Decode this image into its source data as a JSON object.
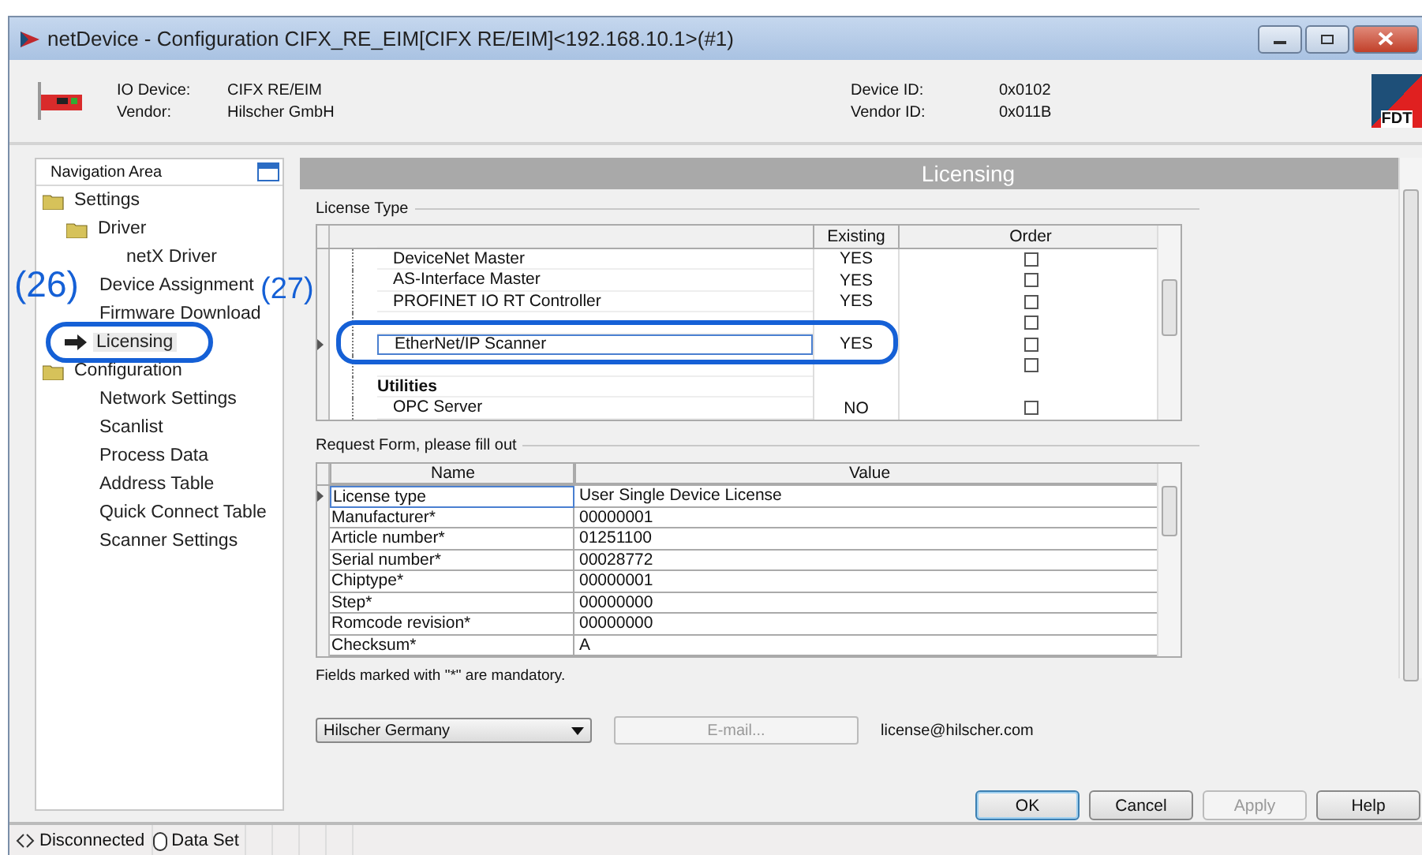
{
  "window": {
    "title": "netDevice - Configuration CIFX_RE_EIM[CIFX RE/EIM]<192.168.10.1>(#1)"
  },
  "device_info": {
    "left": [
      {
        "label": "IO Device:",
        "value": "CIFX RE/EIM"
      },
      {
        "label": "Vendor:",
        "value": "Hilscher GmbH"
      }
    ],
    "right": [
      {
        "label": "Device ID:",
        "value": "0x0102"
      },
      {
        "label": "Vendor ID:",
        "value": "0x011B"
      }
    ],
    "logo_text": "FDT"
  },
  "navigation": {
    "title": "Navigation Area",
    "items": [
      {
        "label": "Settings",
        "kind": "folder",
        "selected": false,
        "children": [
          {
            "label": "Driver",
            "kind": "folder",
            "selected": false,
            "children": [
              {
                "label": "netX Driver",
                "kind": "page",
                "selected": false
              }
            ]
          },
          {
            "label": "Device Assignment",
            "kind": "page",
            "selected": false
          },
          {
            "label": "Firmware Download",
            "kind": "page",
            "selected": false
          },
          {
            "label": "Licensing",
            "kind": "page",
            "selected": true
          }
        ]
      },
      {
        "label": "Configuration",
        "kind": "folder",
        "selected": false,
        "children": [
          {
            "label": "Network Settings",
            "kind": "page",
            "selected": false
          },
          {
            "label": "Scanlist",
            "kind": "page",
            "selected": false
          },
          {
            "label": "Process Data",
            "kind": "page",
            "selected": false
          },
          {
            "label": "Address Table",
            "kind": "page",
            "selected": false
          },
          {
            "label": "Quick Connect Table",
            "kind": "page",
            "selected": false
          },
          {
            "label": "Scanner Settings",
            "kind": "page",
            "selected": false
          }
        ]
      }
    ]
  },
  "annotations": [
    {
      "label": "(26)"
    },
    {
      "label": "(27)"
    }
  ],
  "panel": {
    "title": "Licensing"
  },
  "license_type": {
    "title": "License Type",
    "columns": [
      "Existing",
      "Order"
    ],
    "rows": [
      {
        "kind": "item",
        "name": "DeviceNet Master",
        "existing": "YES",
        "checked": false,
        "selected": false
      },
      {
        "kind": "item",
        "name": "AS-Interface Master",
        "existing": "YES",
        "checked": false,
        "selected": false
      },
      {
        "kind": "item",
        "name": "PROFINET IO RT Controller",
        "existing": "YES",
        "checked": false,
        "selected": false
      },
      {
        "kind": "item",
        "name": "",
        "existing": "",
        "checked": false,
        "selected": false
      },
      {
        "kind": "item",
        "name": "EtherNet/IP Scanner",
        "existing": "YES",
        "checked": false,
        "selected": true
      },
      {
        "kind": "item",
        "name": "",
        "existing": "",
        "checked": false,
        "selected": false
      },
      {
        "kind": "group",
        "name": "Utilities",
        "selected": false
      },
      {
        "kind": "item",
        "name": "OPC Server",
        "existing": "NO",
        "checked": false,
        "selected": false
      }
    ]
  },
  "request_form": {
    "title": "Request Form, please fill out",
    "columns": [
      "Name",
      "Value"
    ],
    "rows": [
      {
        "name": "License type",
        "value": "User Single Device License",
        "selected": true
      },
      {
        "name": "Manufacturer*",
        "value": "00000001",
        "selected": false
      },
      {
        "name": "Article number*",
        "value": "01251100",
        "selected": false
      },
      {
        "name": "Serial number*",
        "value": "00028772",
        "selected": false
      },
      {
        "name": "Chiptype*",
        "value": "00000001",
        "selected": false
      },
      {
        "name": "Step*",
        "value": "00000000",
        "selected": false
      },
      {
        "name": "Romcode revision*",
        "value": "00000000",
        "selected": false
      },
      {
        "name": "Checksum*",
        "value": "A",
        "selected": false
      }
    ],
    "note": "Fields marked with \"*\" are mandatory."
  },
  "contact": {
    "region": "Hilscher Germany",
    "email_button": {
      "label": "E-mail...",
      "disabled": true
    },
    "address": "license@hilscher.com"
  },
  "buttons": [
    {
      "label": "OK",
      "default": true,
      "disabled": false
    },
    {
      "label": "Cancel",
      "default": false,
      "disabled": false
    },
    {
      "label": "Apply",
      "default": false,
      "disabled": true
    },
    {
      "label": "Help",
      "default": false,
      "disabled": false
    }
  ],
  "status_bar": [
    {
      "kind": "connection",
      "label": "Disconnected"
    },
    {
      "kind": "dataset",
      "label": "Data Set"
    }
  ]
}
